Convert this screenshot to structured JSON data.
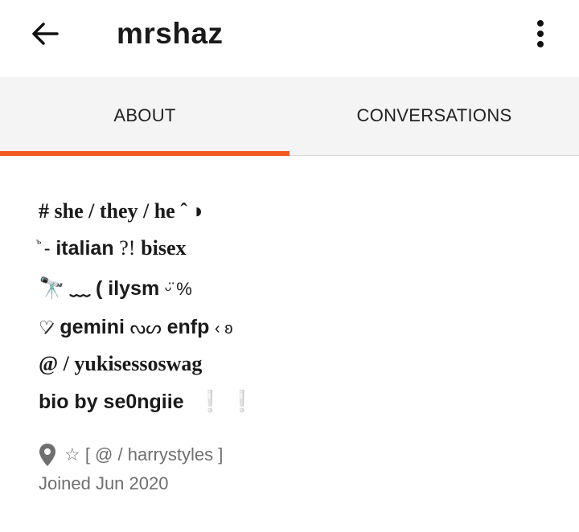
{
  "header": {
    "title": "mrshaz",
    "back_icon": "arrow-left-icon",
    "menu_icon": "kebab-menu-icon"
  },
  "tabs": [
    {
      "label": "ABOUT",
      "active": true
    },
    {
      "label": "CONVERSATIONS",
      "active": false
    }
  ],
  "bio": {
    "line1": "# she / they / he ˆ ◗",
    "line2_symbol": "ꙸ",
    "line2_a": "-",
    "line2_b": "italian",
    "line2_c": "?!",
    "line2_d": "bisex",
    "line3_emoji": "🔭",
    "line3_text": "﹏ ( ilysm",
    "line3_tail": "ᵕ̈ %",
    "line4_a": "♡̷",
    "line4_b": "gemini",
    "line4_c": "ᔓᔕ",
    "line4_d": "enfp",
    "line4_e": "‹ ʚ",
    "line5": "@ / yukisessoswag",
    "line6_a": "bio by se0ngiie",
    "line6_b": "❕ ❕"
  },
  "meta": {
    "location_icon": "location-pin-icon",
    "location": "☆ [ @ / harrystyles ]",
    "joined": "Joined Jun 2020"
  },
  "colors": {
    "accent": "#f25a21",
    "tab_bg": "#f4f4f4",
    "meta_text": "#6f6f6f"
  }
}
